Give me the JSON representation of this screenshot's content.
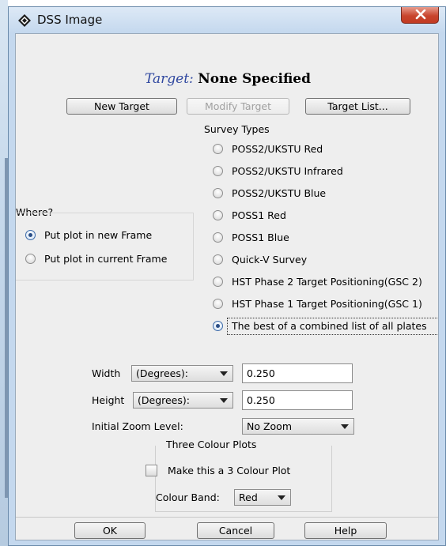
{
  "window": {
    "title": "DSS Image",
    "close_label": "X"
  },
  "target": {
    "label": "Target:",
    "value": "None Specified"
  },
  "buttons": {
    "new_target": "New Target",
    "modify_target": "Modify Target",
    "target_list": "Target List..."
  },
  "survey": {
    "title": "Survey Types",
    "selected_index": 8,
    "options": [
      "POSS2/UKSTU Red",
      "POSS2/UKSTU Infrared",
      "POSS2/UKSTU Blue",
      "POSS1 Red",
      "POSS1 Blue",
      "Quick-V Survey",
      "HST Phase 2 Target Positioning(GSC 2)",
      "HST Phase 1 Target Positioning(GSC 1)",
      "The best of a combined list of all plates"
    ]
  },
  "where": {
    "title": "Where?",
    "options": [
      "Put plot in new Frame",
      "Put plot in current Frame"
    ],
    "selected_index": 0
  },
  "size": {
    "width_label": "Width",
    "width_unit": "(Degrees):",
    "width_value": "0.250",
    "height_label": "Height",
    "height_unit": "(Degrees):",
    "height_value": "0.250",
    "zoom_label": "Initial Zoom Level:",
    "zoom_value": "No Zoom"
  },
  "colour": {
    "title": "Three Colour Plots",
    "make_3colour_label": "Make this a 3 Colour Plot",
    "make_3colour_checked": false,
    "band_label": "Colour Band:",
    "band_value": "Red"
  },
  "footer": {
    "ok": "OK",
    "cancel": "Cancel",
    "help": "Help"
  },
  "colors": {
    "title_bar": "#c4d8ee",
    "close_button": "#c8452e",
    "target_label": "#3048a0",
    "panel_bg": "#eeeeee"
  },
  "icons": {
    "app": "diamond-app-icon",
    "close": "close-icon",
    "dropdown": "chevron-down-icon"
  }
}
